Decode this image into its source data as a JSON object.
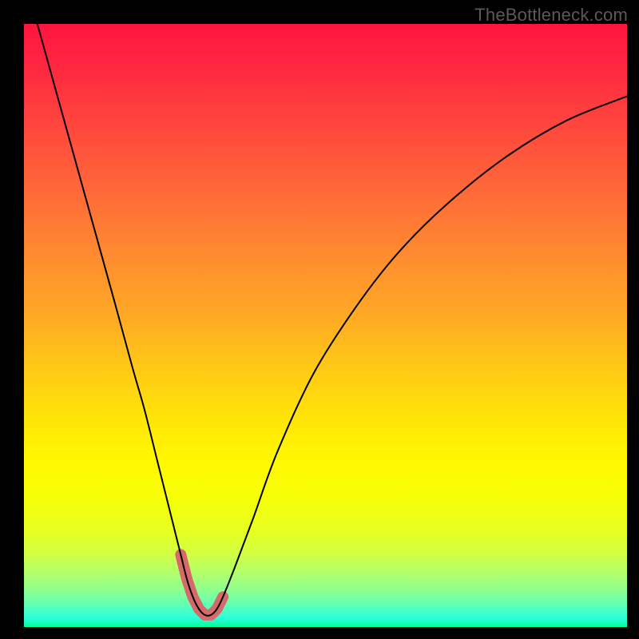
{
  "watermark": "TheBottleneck.com",
  "chart_data": {
    "type": "line",
    "title": "",
    "xlabel": "",
    "ylabel": "",
    "xlim": [
      0,
      100
    ],
    "ylim": [
      0,
      100
    ],
    "series": [
      {
        "name": "bottleneck-curve",
        "x": [
          0,
          5,
          10,
          15,
          18,
          20,
          22,
          24,
          26,
          27,
          28,
          29,
          30,
          31,
          32,
          33,
          35,
          38,
          42,
          48,
          55,
          62,
          70,
          80,
          90,
          100
        ],
        "values": [
          108,
          90,
          72,
          54,
          43,
          36,
          28,
          20,
          12,
          8,
          5,
          3,
          2,
          2,
          3,
          5,
          10,
          18,
          29,
          42,
          53,
          62,
          70,
          78,
          84,
          88
        ]
      }
    ],
    "highlight_region": {
      "name": "optimal-zone",
      "x_start": 26,
      "x_end": 33,
      "color": "#d66a6a"
    },
    "gradient_stops": [
      {
        "pos": 0,
        "color": "#ff153f"
      },
      {
        "pos": 50,
        "color": "#ffc518"
      },
      {
        "pos": 75,
        "color": "#fff700"
      },
      {
        "pos": 100,
        "color": "#00ff94"
      }
    ]
  }
}
